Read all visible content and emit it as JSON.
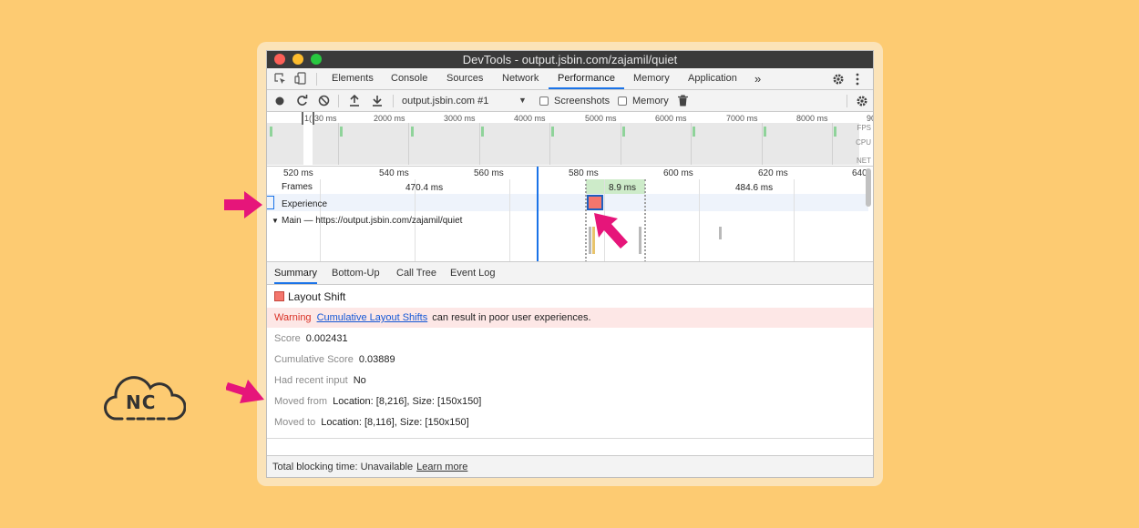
{
  "window": {
    "title": "DevTools - output.jsbin.com/zajamil/quiet"
  },
  "tabs": [
    {
      "label": "Elements"
    },
    {
      "label": "Console"
    },
    {
      "label": "Sources"
    },
    {
      "label": "Network"
    },
    {
      "label": "Performance",
      "active": true
    },
    {
      "label": "Memory"
    },
    {
      "label": "Application"
    }
  ],
  "tabs_more": "»",
  "toolbar": {
    "profile_select": "output.jsbin.com #1",
    "screenshots_label": "Screenshots",
    "memory_label": "Memory"
  },
  "overview": {
    "ticks": [
      "1(",
      "30 ms",
      "2000 ms",
      "3000 ms",
      "4000 ms",
      "5000 ms",
      "6000 ms",
      "7000 ms",
      "8000 ms",
      "90"
    ],
    "fps_label": "FPS",
    "cpu_label": "CPU",
    "net_label": "NET"
  },
  "timeline": {
    "ticks": [
      "520 ms",
      "540 ms",
      "560 ms",
      "580 ms",
      "600 ms",
      "620 ms",
      "640"
    ],
    "frames_label": "Frames",
    "frame_times": [
      "470.4 ms",
      "8.9 ms",
      "484.6 ms"
    ],
    "experience_label": "Experience",
    "main_label": "Main — https://output.jsbin.com/zajamil/quiet"
  },
  "bottom_tabs": [
    {
      "label": "Summary",
      "active": true
    },
    {
      "label": "Bottom-Up"
    },
    {
      "label": "Call Tree"
    },
    {
      "label": "Event Log"
    }
  ],
  "summary": {
    "title": "Layout Shift",
    "warning_label": "Warning",
    "warning_link": "Cumulative Layout Shifts",
    "warning_text": "can result in poor user experiences.",
    "score_label": "Score",
    "score_value": "0.002431",
    "cumulative_label": "Cumulative Score",
    "cumulative_value": "0.03889",
    "input_label": "Had recent input",
    "input_value": "No",
    "moved_from_label": "Moved from",
    "moved_from_value": "Location: [8,216], Size: [150x150]",
    "moved_to_label": "Moved to",
    "moved_to_value": "Location: [8,116], Size: [150x150]"
  },
  "footer": {
    "text": "Total blocking time: Unavailable",
    "link": "Learn more"
  },
  "logo": {
    "text": "NC"
  },
  "colors": {
    "background": "#fdcb72",
    "accent": "#1a73e8",
    "layout_shift": "#f4766d",
    "arrow": "#e6157a"
  }
}
